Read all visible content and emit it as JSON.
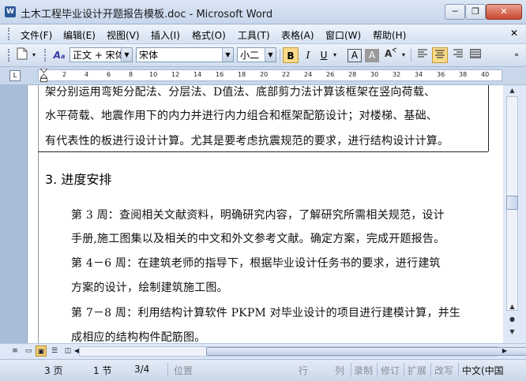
{
  "window": {
    "title": "土木工程毕业设计开题报告模板.doc - Microsoft Word",
    "icon": "word-doc-icon",
    "minimize": "─",
    "restore": "❐",
    "close": "✕"
  },
  "menu": [
    "文件(F)",
    "编辑(E)",
    "视图(V)",
    "插入(I)",
    "格式(O)",
    "工具(T)",
    "表格(A)",
    "窗口(W)",
    "帮助(H)"
  ],
  "toolbar": {
    "style_value": "正文 + 宋体",
    "font_value": "宋体",
    "size_value": "小二",
    "bold": "B",
    "italic": "I",
    "underline": "U",
    "char_border": "A",
    "char_shading": "A"
  },
  "ruler": {
    "ticks": [
      "2",
      "4",
      "6",
      "8",
      "10",
      "12",
      "14",
      "16",
      "18",
      "20",
      "22",
      "24",
      "26",
      "28",
      "30",
      "32",
      "34",
      "36",
      "38",
      "40"
    ]
  },
  "document": {
    "lines_top": [
      "架分别运用弯矩分配法、分层法、D值法、底部剪力法计算该框架在竖向荷载、",
      "水平荷载、地震作用下的内力并进行内力组合和框架配筋设计；对楼梯、基础、",
      "有代表性的板进行设计计算。尤其是要考虑抗震规范的要求，进行结构设计计算。"
    ],
    "section_title": "3. 进度安排",
    "schedule_lines": [
      "第 3 周：查阅相关文献资料，明确研究内容，了解研究所需相关规范，设计",
      "手册,施工图集以及相关的中文和外文参考文献。确定方案，完成开题报告。",
      "第 4－6 周：在建筑老师的指导下，根据毕业设计任务书的要求，进行建筑",
      "方案的设计，绘制建筑施工图。",
      "第 7－8 周：利用结构计算软件 PKPM 对毕业设计的项目进行建模计算，并生",
      "成相应的结构构件配筋图。"
    ]
  },
  "status": {
    "page": "3 页",
    "section": "1 节",
    "page_of": "3/4",
    "position": "位置",
    "line": "行",
    "column": "列",
    "rec": "录制",
    "trk": "修订",
    "ext": "扩展",
    "ovr": "改写",
    "language": "中文(中国"
  }
}
